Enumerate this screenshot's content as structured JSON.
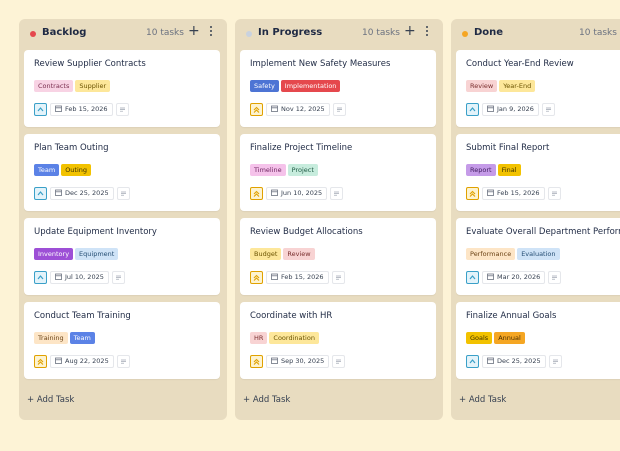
{
  "columns": [
    {
      "title": "Backlog",
      "count": "10 tasks",
      "dot_color": "#e5484d",
      "add_label": "+",
      "add_task": "+ Add Task",
      "cards": [
        {
          "title": "Review Supplier Contracts",
          "tags": [
            {
              "label": "Contracts",
              "bg": "#f8d3e4",
              "fg": "#7a2e4f"
            },
            {
              "label": "Supplier",
              "bg": "#fde79a",
              "fg": "#6b5300"
            }
          ],
          "priority": "up",
          "date": "Feb 15, 2026"
        },
        {
          "title": "Plan Team Outing",
          "tags": [
            {
              "label": "Team",
              "bg": "#5b82e6",
              "fg": "#ffffff"
            },
            {
              "label": "Outing",
              "bg": "#f2c200",
              "fg": "#3d3000"
            }
          ],
          "priority": "up",
          "date": "Dec 25, 2025"
        },
        {
          "title": "Update Equipment Inventory",
          "tags": [
            {
              "label": "Inventory",
              "bg": "#9d4fd6",
              "fg": "#ffffff"
            },
            {
              "label": "Equipment",
              "bg": "#cfe3f7",
              "fg": "#244d73"
            }
          ],
          "priority": "up",
          "date": "Jul 10, 2025"
        },
        {
          "title": "Conduct Team Training",
          "tags": [
            {
              "label": "Training",
              "bg": "#fde5c6",
              "fg": "#6b4316"
            },
            {
              "label": "Team",
              "bg": "#5b82e6",
              "fg": "#ffffff"
            }
          ],
          "priority": "double",
          "date": "Aug 22, 2025"
        }
      ]
    },
    {
      "title": "In Progress",
      "count": "10 tasks",
      "dot_color": "#c9d2df",
      "add_label": "+",
      "add_task": "+ Add Task",
      "cards": [
        {
          "title": "Implement New Safety Measures",
          "tags": [
            {
              "label": "Safety",
              "bg": "#4d74d4",
              "fg": "#ffffff"
            },
            {
              "label": "Implementation",
              "bg": "#e5484d",
              "fg": "#ffffff"
            }
          ],
          "priority": "double",
          "date": "Nov 12, 2025"
        },
        {
          "title": "Finalize Project Timeline",
          "tags": [
            {
              "label": "Timeline",
              "bg": "#f5c2ea",
              "fg": "#6e2460"
            },
            {
              "label": "Project",
              "bg": "#c7ecdd",
              "fg": "#1e5a44"
            }
          ],
          "priority": "double",
          "date": "Jun 10, 2025"
        },
        {
          "title": "Review Budget Allocations",
          "tags": [
            {
              "label": "Budget",
              "bg": "#fde79a",
              "fg": "#6b5300"
            },
            {
              "label": "Review",
              "bg": "#f8d3d3",
              "fg": "#7a2e2e"
            }
          ],
          "priority": "double",
          "date": "Feb 15, 2026"
        },
        {
          "title": "Coordinate with HR",
          "tags": [
            {
              "label": "HR",
              "bg": "#f8d3d3",
              "fg": "#7a2e2e"
            },
            {
              "label": "Coordination",
              "bg": "#fde79a",
              "fg": "#6b5300"
            }
          ],
          "priority": "double",
          "date": "Sep 30, 2025"
        }
      ]
    },
    {
      "title": "Done",
      "count": "10 tasks",
      "dot_color": "#f5a623",
      "add_label": "+",
      "add_task": "+ Add Task",
      "cards": [
        {
          "title": "Conduct Year-End Review",
          "tags": [
            {
              "label": "Review",
              "bg": "#f8d3d3",
              "fg": "#7a2e2e"
            },
            {
              "label": "Year-End",
              "bg": "#fde79a",
              "fg": "#6b5300"
            }
          ],
          "priority": "up",
          "date": "Jan 9, 2026"
        },
        {
          "title": "Submit Final Report",
          "tags": [
            {
              "label": "Report",
              "bg": "#c59be8",
              "fg": "#3e1a5e"
            },
            {
              "label": "Final",
              "bg": "#f2c200",
              "fg": "#3d3000"
            }
          ],
          "priority": "double",
          "date": "Feb 15, 2026"
        },
        {
          "title": "Evaluate Overall Department Performance",
          "tags": [
            {
              "label": "Performance",
              "bg": "#fde5c6",
              "fg": "#6b4316"
            },
            {
              "label": "Evaluation",
              "bg": "#cfe3f7",
              "fg": "#244d73"
            }
          ],
          "priority": "up",
          "date": "Mar 20, 2026"
        },
        {
          "title": "Finalize Annual Goals",
          "tags": [
            {
              "label": "Goals",
              "bg": "#f2c200",
              "fg": "#3d3000"
            },
            {
              "label": "Annual",
              "bg": "#f5a623",
              "fg": "#4a2e00"
            }
          ],
          "priority": "up",
          "date": "Dec 25, 2025"
        }
      ]
    }
  ],
  "icons": {
    "priority_up_color": "#3aa0c8",
    "priority_up_bg": "#e3f3fa",
    "priority_double_color": "#e0a100",
    "priority_double_bg": "#fdf3d0"
  }
}
